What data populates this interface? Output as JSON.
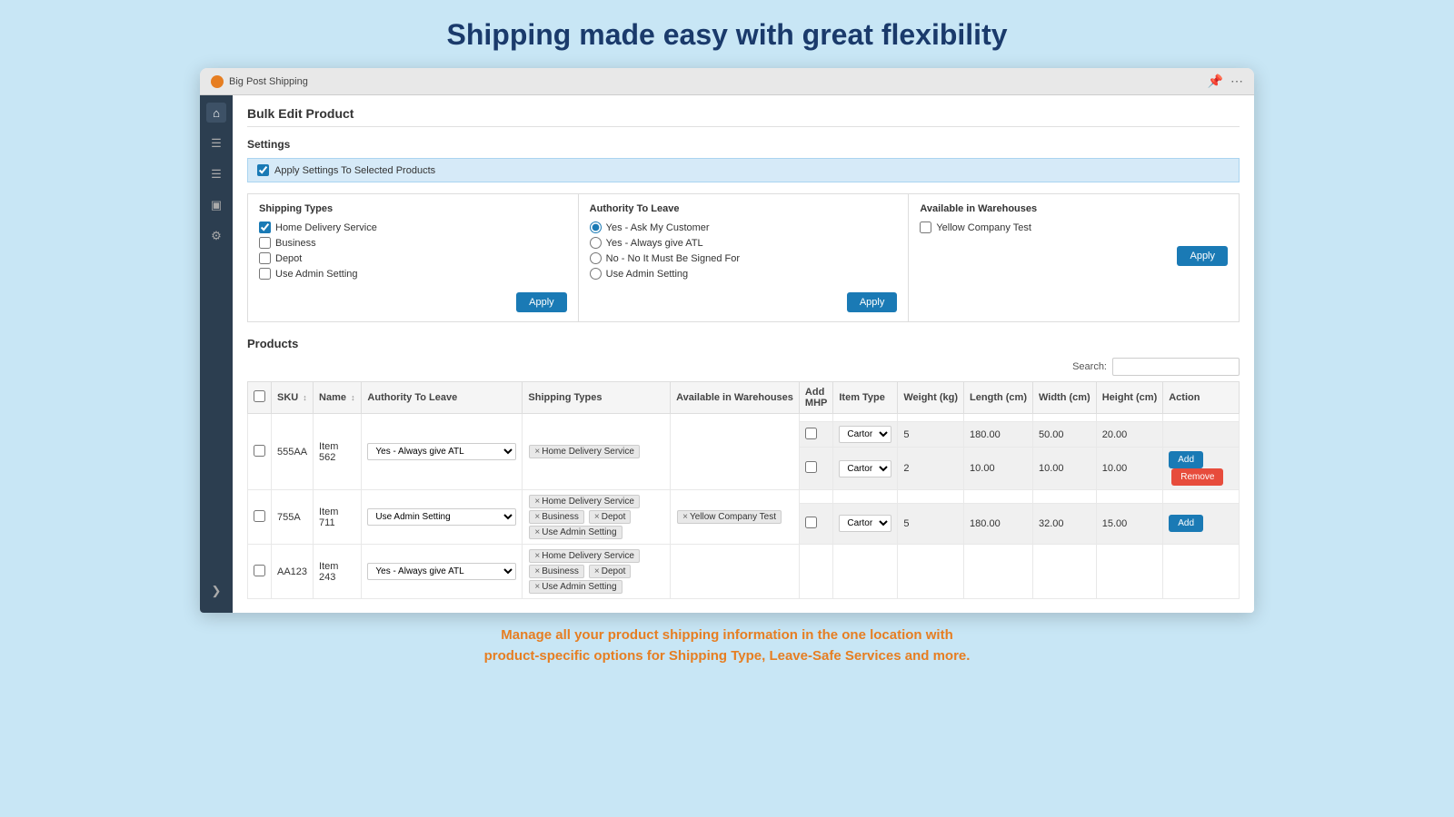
{
  "page": {
    "title": "Shipping made easy with great flexibility",
    "footer_text": "Manage all your product shipping information in the one location with\nproduct-specific options for Shipping Type, Leave-Safe Services and more."
  },
  "browser": {
    "app_name": "Big Post Shipping",
    "pin_icon": "📌",
    "more_icon": "⋯"
  },
  "bulk_edit": {
    "header": "Bulk Edit Product",
    "settings_label": "Settings",
    "apply_settings_label": "Apply Settings To Selected Products"
  },
  "shipping_types": {
    "title": "Shipping Types",
    "options": [
      {
        "label": "Home Delivery Service",
        "checked": true
      },
      {
        "label": "Business",
        "checked": false
      },
      {
        "label": "Depot",
        "checked": false
      },
      {
        "label": "Use Admin Setting",
        "checked": false
      }
    ],
    "apply_label": "Apply"
  },
  "authority_to_leave": {
    "title": "Authority To Leave",
    "options": [
      {
        "label": "Yes - Ask My Customer",
        "checked": true
      },
      {
        "label": "Yes - Always give ATL",
        "checked": false
      },
      {
        "label": "No - No It Must Be Signed For",
        "checked": false
      },
      {
        "label": "Use Admin Setting",
        "checked": false
      }
    ],
    "apply_label": "Apply"
  },
  "available_warehouses": {
    "title": "Available in Warehouses",
    "options": [
      {
        "label": "Yellow Company Test",
        "checked": false
      }
    ],
    "apply_label": "Apply"
  },
  "products": {
    "section_title": "Products",
    "search_label": "Search:",
    "search_placeholder": "",
    "columns": [
      "SKU",
      "Name",
      "Authority To Leave",
      "Shipping Types",
      "Available in Warehouses",
      "Add MHP",
      "Item Type",
      "Weight (kg)",
      "Length (cm)",
      "Width (cm)",
      "Height (cm)",
      "Action"
    ],
    "rows": [
      {
        "id": "row1",
        "sku": "555AA",
        "name": "Item 562",
        "atl": "Yes - Always give ATL",
        "shipping_types": [
          "Home Delivery Service"
        ],
        "warehouses": [],
        "sub_rows": [
          {
            "item_type": "Cartor",
            "weight": "5",
            "length": "180.00",
            "width": "50.00",
            "height": "20.00",
            "has_add": false,
            "has_remove": false
          },
          {
            "item_type": "Cartor",
            "weight": "2",
            "length": "10.00",
            "width": "10.00",
            "height": "10.00",
            "has_add": true,
            "has_remove": true
          }
        ]
      },
      {
        "id": "row2",
        "sku": "755A",
        "name": "Item 711",
        "atl": "Use Admin Setting",
        "shipping_types": [
          "Home Delivery Service",
          "Business",
          "Depot",
          "Use Admin Setting"
        ],
        "warehouses": [
          "Yellow Company Test"
        ],
        "sub_rows": [
          {
            "item_type": "Cartor",
            "weight": "5",
            "length": "180.00",
            "width": "32.00",
            "height": "15.00",
            "has_add": true,
            "has_remove": false
          }
        ]
      },
      {
        "id": "row3",
        "sku": "AA123",
        "name": "Item 243",
        "atl": "Yes - Always give ATL",
        "shipping_types": [
          "Home Delivery Service",
          "Business",
          "Depot",
          "Use Admin Setting"
        ],
        "warehouses": [],
        "sub_rows": []
      }
    ],
    "add_label": "Add",
    "remove_label": "Remove"
  }
}
